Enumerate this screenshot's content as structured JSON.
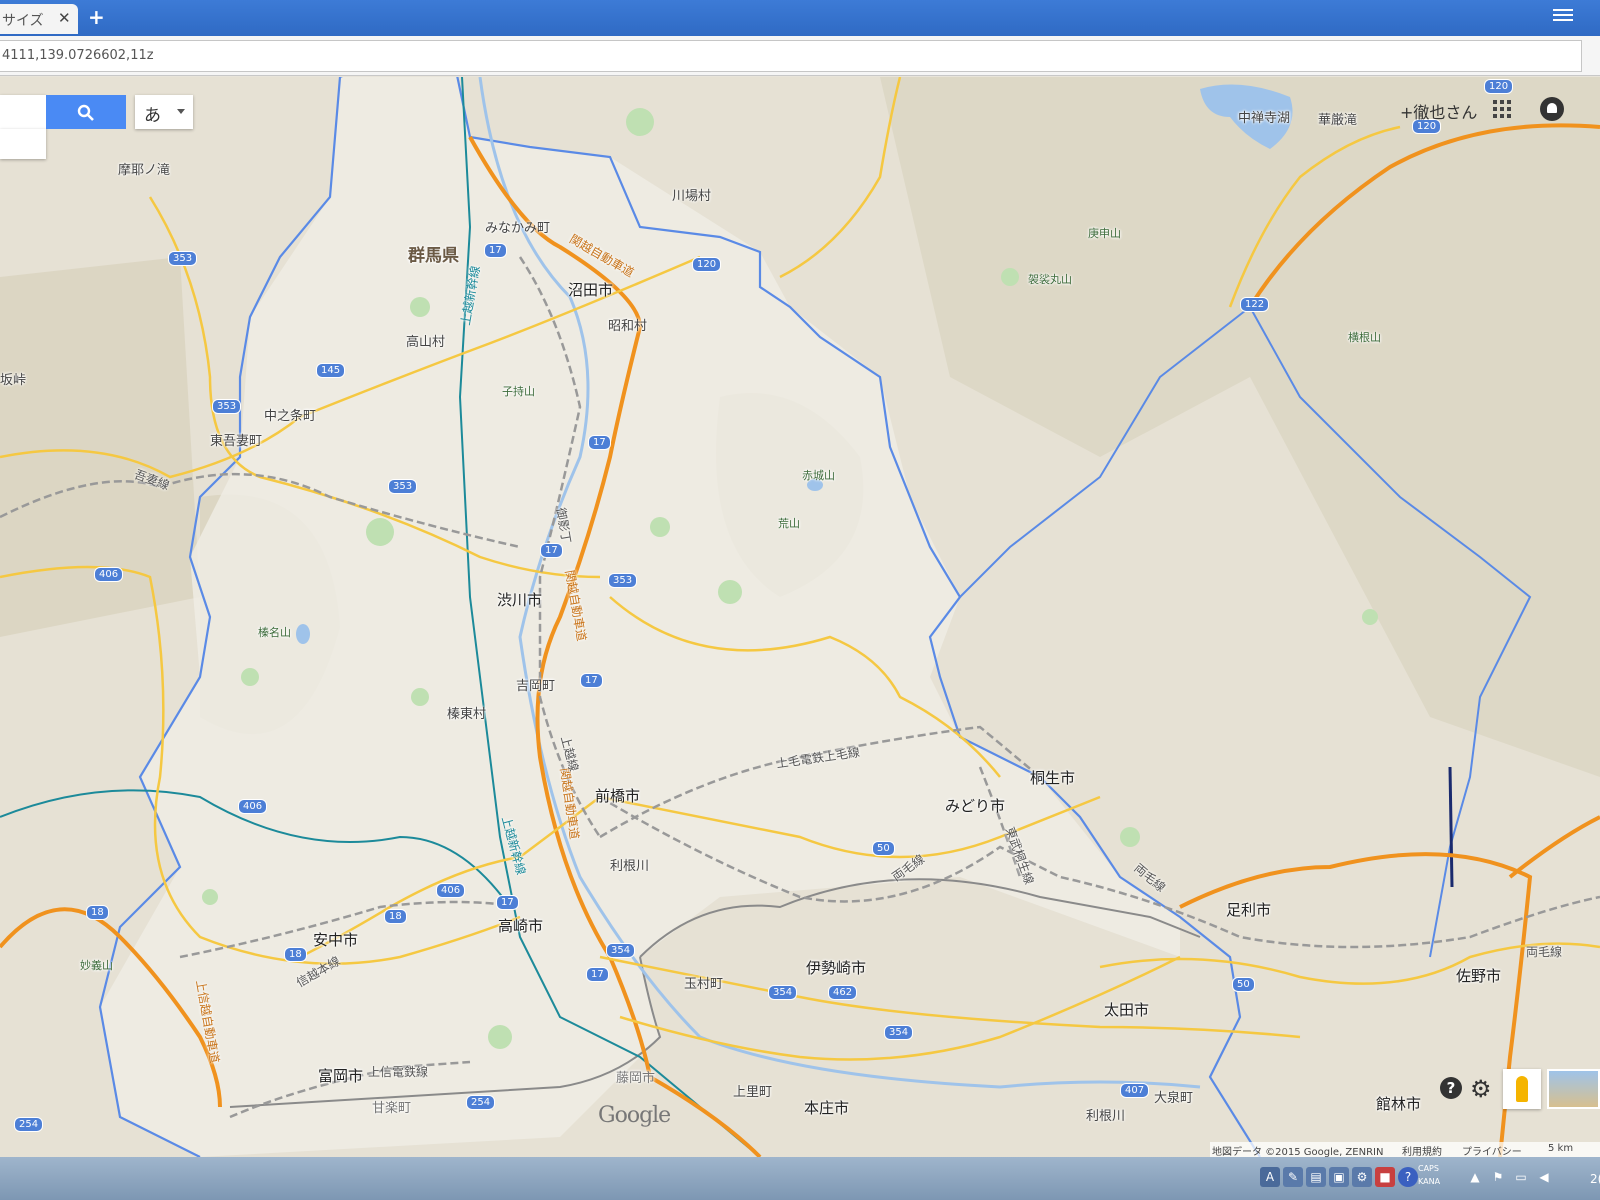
{
  "browser": {
    "tab_title": "サイズ",
    "tab_close": "✕",
    "new_tab": "+",
    "url": "4111,139.0726602,11z"
  },
  "map": {
    "ime_label": "あ",
    "user_name": "+徹也さん",
    "google_logo": "Google",
    "attribution": {
      "data": "地図データ ©2015 Google, ZENRIN",
      "terms": "利用規約",
      "privacy": "プライバシー",
      "scale": "5 km"
    },
    "labels": {
      "pref": "群馬県",
      "numata": "沼田市",
      "showa": "昭和村",
      "minakami": "みなかみ町",
      "kawaba": "川場村",
      "takayama": "高山村",
      "nakanojo": "中之条町",
      "higashiagatsuma": "東吾妻町",
      "shibukawa": "渋川市",
      "yoshioka": "吉岡町",
      "shinto": "榛東村",
      "maebashi": "前橋市",
      "takasaki": "高崎市",
      "annaka": "安中市",
      "tomioka": "富岡市",
      "kanra": "甘楽町",
      "fujioka": "藤岡市",
      "tamamura": "玉村町",
      "isesaki": "伊勢崎市",
      "kamisato": "上里町",
      "honjo": "本庄市",
      "ota": "太田市",
      "oizumi": "大泉町",
      "tonegawa": "利根川",
      "midori": "みどり市",
      "kiryu": "桐生市",
      "ashikaga": "足利市",
      "sano": "佐野市",
      "tatebayashi": "館林市",
      "chuzenji": "中禅寺湖",
      "kegon": "華厳滝",
      "maya": "摩耶ノ滝",
      "saka": "坂峠",
      "kinu": "利根川",
      "tone2": "利根川"
    },
    "peaks": {
      "koshin": "庚申山",
      "kesamaru": "袈裟丸山",
      "yokone": "横根山",
      "komochi": "子持山",
      "akagi": "赤城山",
      "ara": "荒山",
      "haruna": "榛名山",
      "myogi": "妙義山"
    },
    "lines": {
      "agatsuma": "吾妻線",
      "joetsu_shinkansen": "上越新幹線",
      "joetsu_shinkansen2": "上越新幹線",
      "kanetsu": "関越自動車道",
      "kanetsu2": "関越自動車道",
      "kanetsu3": "関越自動車道",
      "joetsu": "上越線",
      "jomo": "上毛電鉄上毛線",
      "ryomo": "両毛線",
      "ryomo2": "両毛線",
      "ryomo3": "両毛線",
      "tobu": "東武桐生線",
      "shinetsu": "信越本線",
      "joshin": "上信電鉄線",
      "jonetsu": "上信越自動車道",
      "mikuni": "御影丁"
    },
    "routes": [
      "17",
      "120",
      "353",
      "145",
      "353",
      "17",
      "17",
      "353",
      "406",
      "17",
      "17",
      "406",
      "406",
      "17",
      "18",
      "18",
      "354",
      "17",
      "354",
      "462",
      "354",
      "50",
      "50",
      "407",
      "254",
      "254",
      "122",
      "120",
      "120",
      "120",
      "18"
    ]
  },
  "taskbar": {
    "caps": "CAPS",
    "kana": "KANA",
    "clock_fragment": "2("
  }
}
